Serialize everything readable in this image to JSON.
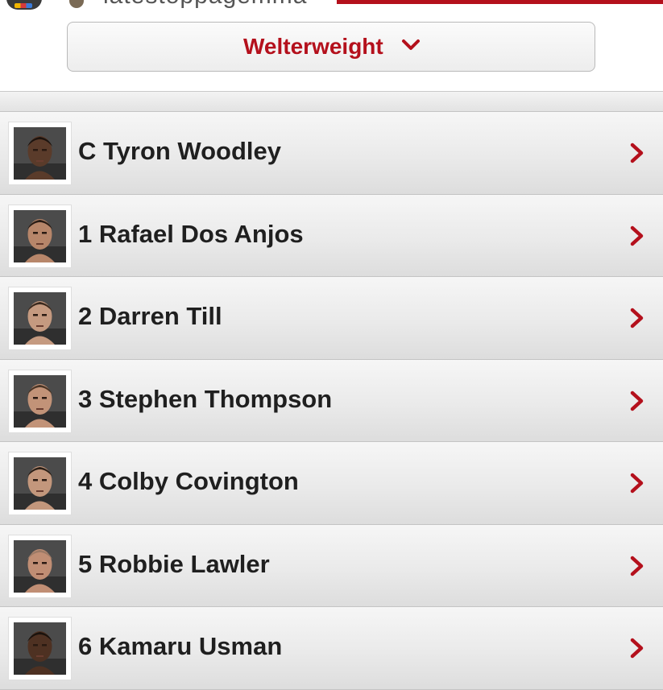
{
  "repost": {
    "handle": "latestoppagemma"
  },
  "division_selector": {
    "label": "Welterweight"
  },
  "rankings": [
    {
      "rank_name": "C Tyron Woodley",
      "skin": "#5a3b2a",
      "hair": "#1d140f"
    },
    {
      "rank_name": "1 Rafael Dos Anjos",
      "skin": "#b7866a",
      "hair": "#2a1d16"
    },
    {
      "rank_name": "2 Darren Till",
      "skin": "#c59a80",
      "hair": "#3b2a1f"
    },
    {
      "rank_name": "3 Stephen Thompson",
      "skin": "#c29378",
      "hair": "#4a3526"
    },
    {
      "rank_name": "4 Colby Covington",
      "skin": "#c3977c",
      "hair": "#2b2018"
    },
    {
      "rank_name": "5 Robbie Lawler",
      "skin": "#c08e74",
      "hair": "#9c7a66"
    },
    {
      "rank_name": "6 Kamaru Usman",
      "skin": "#4e3122",
      "hair": "#1a120d"
    }
  ],
  "colors": {
    "accent": "#b4101c",
    "text": "#1f1f1f"
  }
}
